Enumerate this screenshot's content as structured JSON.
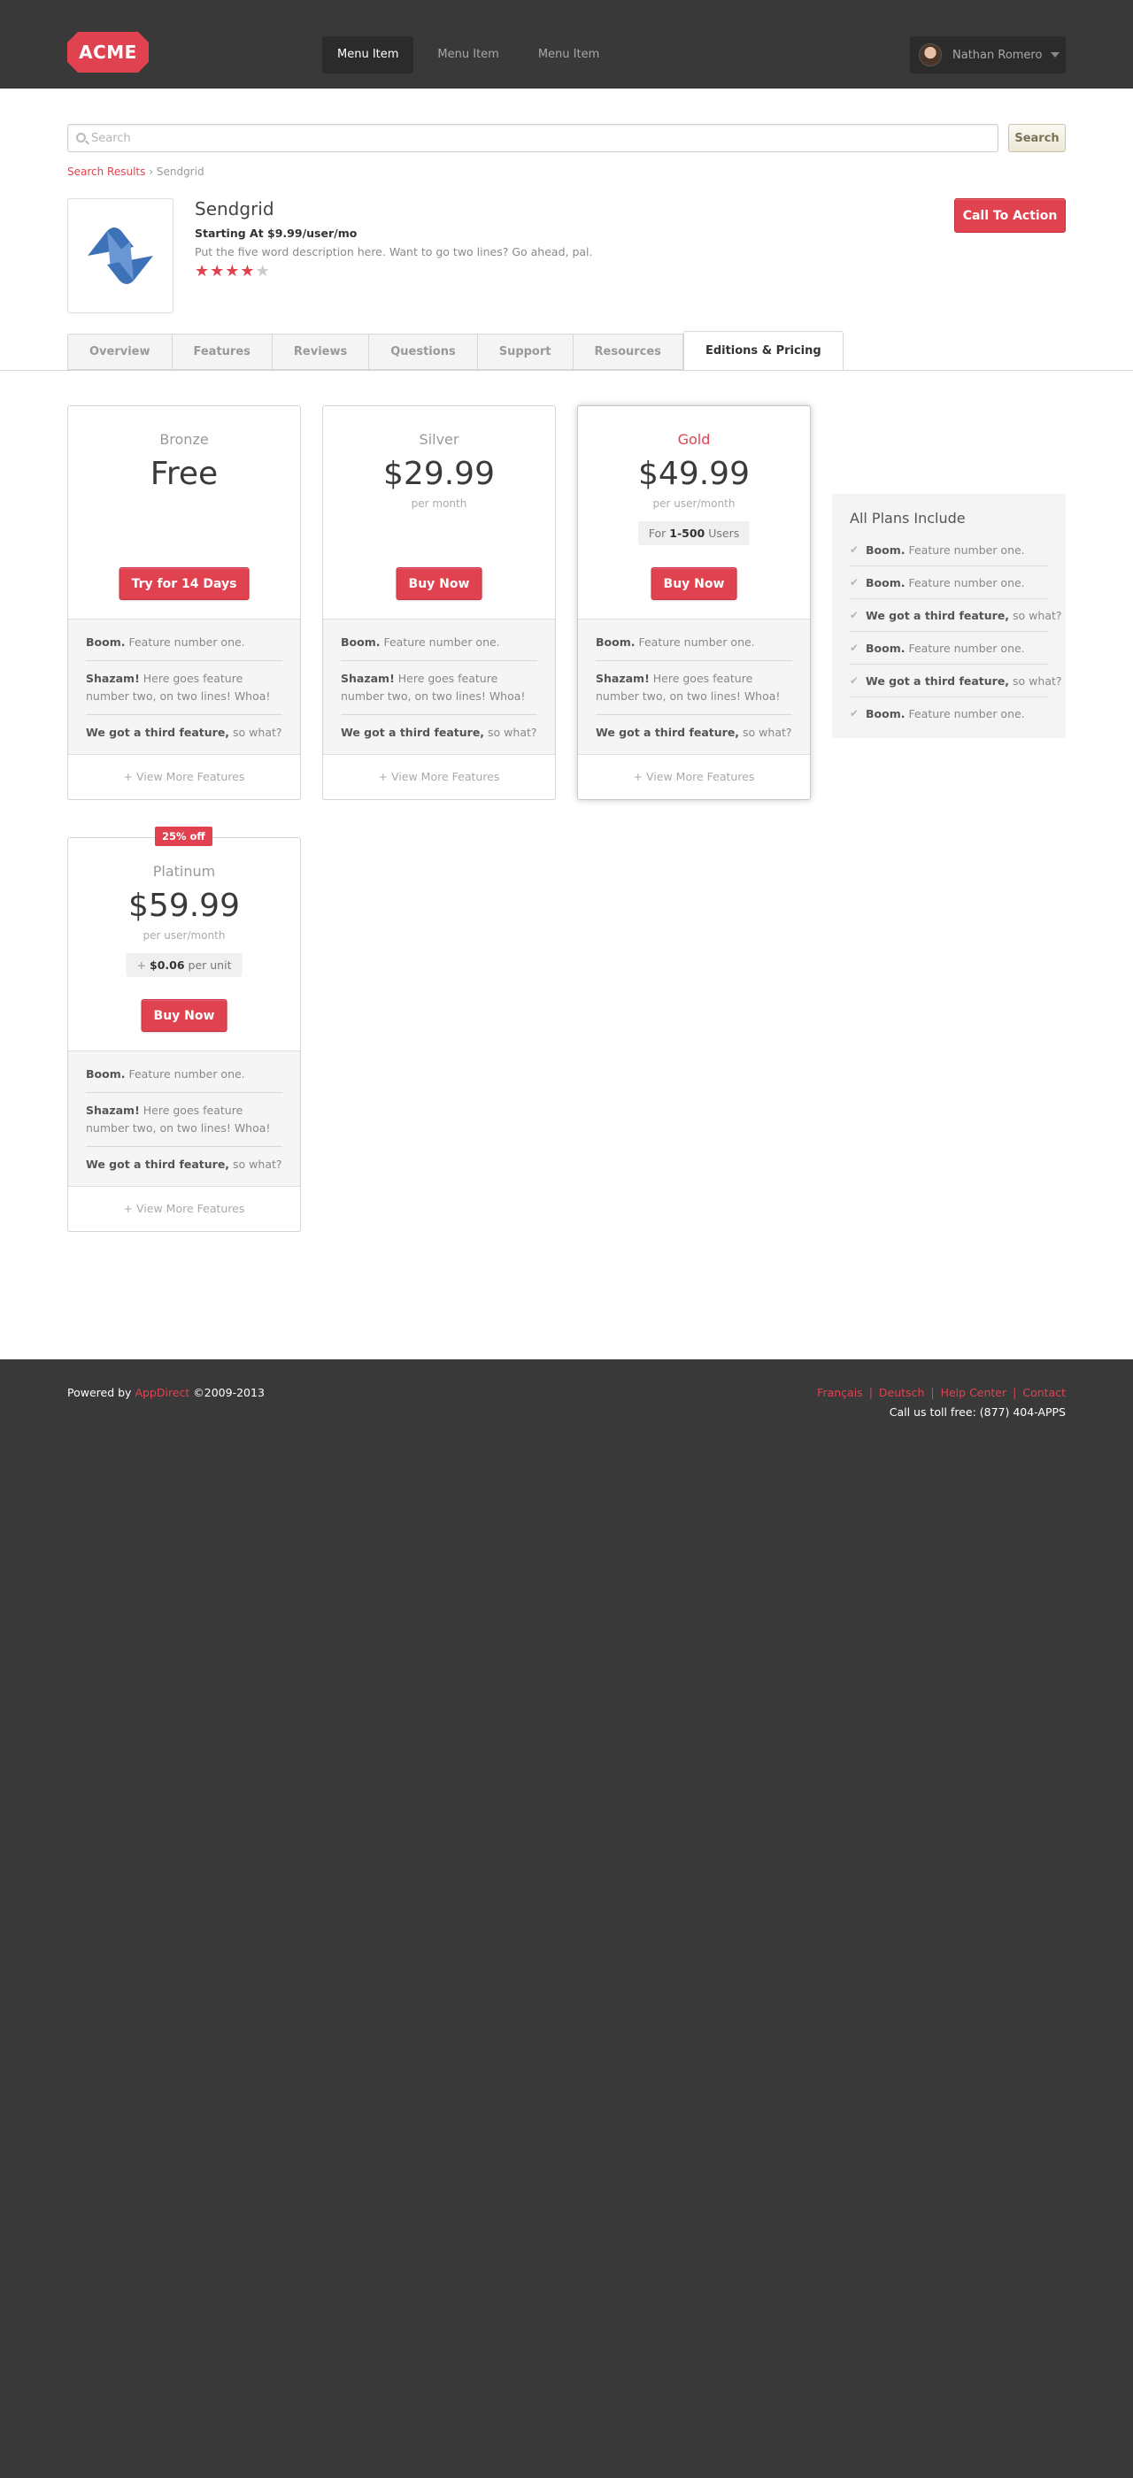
{
  "header": {
    "logo_text": "ACME",
    "menu": [
      "Menu Item",
      "Menu Item",
      "Menu Item"
    ],
    "user_name": "Nathan Romero"
  },
  "search": {
    "placeholder": "Search",
    "button_label": "Search"
  },
  "breadcrumb": {
    "link": "Search Results",
    "separator": "›",
    "current": "Sendgrid"
  },
  "app": {
    "name": "Sendgrid",
    "price": "Starting At $9.99/user/mo",
    "description": "Put the five word description here. Want to go two lines? Go ahead, pal.",
    "rating": 4,
    "rating_max": 5,
    "cta_label": "Call To Action"
  },
  "tabs": [
    "Overview",
    "Features",
    "Reviews",
    "Questions",
    "Support",
    "Resources",
    "Editions & Pricing"
  ],
  "plans": [
    {
      "name": "Bronze",
      "price": "Free",
      "period": "",
      "button": "Try for 14 Days",
      "features": [
        {
          "bold": "Boom.",
          "text": " Feature number one."
        },
        {
          "bold": "Shazam!",
          "text": " Here goes feature number two, on two lines! Whoa!"
        },
        {
          "bold": "We got a third feature,",
          "text": " so what?"
        }
      ],
      "view_more": "+ View More Features"
    },
    {
      "name": "Silver",
      "price": "$29.99",
      "period": "per month",
      "button": "Buy Now",
      "features": [
        {
          "bold": "Boom.",
          "text": " Feature number one."
        },
        {
          "bold": "Shazam!",
          "text": " Here goes feature number two, on two lines! Whoa!"
        },
        {
          "bold": "We got a third feature,",
          "text": " so what?"
        }
      ],
      "view_more": "+ View More Features"
    },
    {
      "name": "Gold",
      "price": "$49.99",
      "period": "per user/month",
      "extra_pre": "For ",
      "extra_bold": "1-500",
      "extra_post": " Users",
      "button": "Buy Now",
      "features": [
        {
          "bold": "Boom.",
          "text": " Feature number one."
        },
        {
          "bold": "Shazam!",
          "text": " Here goes feature number two, on two lines! Whoa!"
        },
        {
          "bold": "We got a third feature,",
          "text": " so what?"
        }
      ],
      "view_more": "+ View More Features"
    },
    {
      "name": "Platinum",
      "badge": "25% off",
      "price": "$59.99",
      "period": "per user/month",
      "extra_bold": "$0.06",
      "extra_post": " per unit",
      "button": "Buy Now",
      "features": [
        {
          "bold": "Boom.",
          "text": " Feature number one."
        },
        {
          "bold": "Shazam!",
          "text": " Here goes feature number two, on two lines! Whoa!"
        },
        {
          "bold": "We got a third feature,",
          "text": " so what?"
        }
      ],
      "view_more": "+ View More Features"
    }
  ],
  "all_plans": {
    "title": "All Plans Include",
    "items": [
      {
        "bold": "Boom.",
        "text": " Feature number one."
      },
      {
        "bold": "Boom.",
        "text": " Feature number one."
      },
      {
        "bold": "We got a third feature,",
        "text": " so what?"
      },
      {
        "bold": "Boom.",
        "text": " Feature number one."
      },
      {
        "bold": "We got a third feature,",
        "text": " so what?"
      },
      {
        "bold": "Boom.",
        "text": " Feature number one."
      }
    ]
  },
  "footer": {
    "powered_pre": "Powered by ",
    "powered_link": "AppDirect",
    "powered_post": " ©2009-2013",
    "links": [
      "Français",
      "Deutsch",
      "Help Center",
      "Contact"
    ],
    "tollfree": "Call us toll free: (877) 404-APPS"
  },
  "colors": {
    "accent": "#e0424f",
    "dark_bg": "#3a393a"
  }
}
